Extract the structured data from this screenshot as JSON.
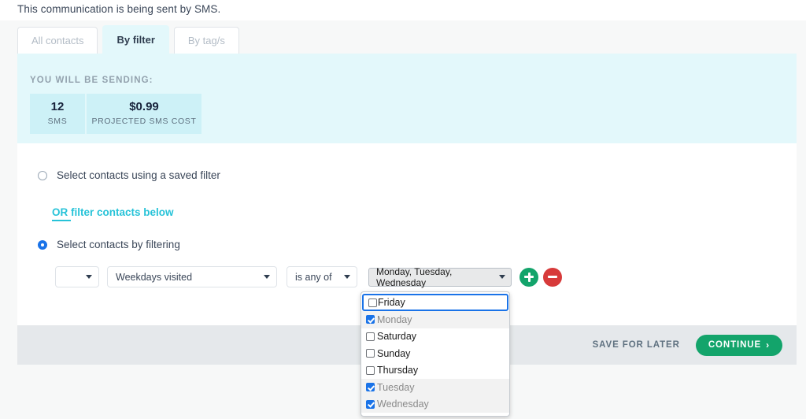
{
  "notice": "This communication is being sent by SMS.",
  "tabs": [
    {
      "label": "All contacts",
      "active": false
    },
    {
      "label": "By filter",
      "active": true
    },
    {
      "label": "By tag/s",
      "active": false
    }
  ],
  "summary": {
    "title": "YOU WILL BE SENDING:",
    "stats": [
      {
        "value": "12",
        "label": "SMS"
      },
      {
        "value": "$0.99",
        "label": "PROJECTED SMS COST"
      }
    ]
  },
  "options_section": {
    "saved_filter_label": "Select contacts using a saved filter",
    "or_link_label": "OR filter contacts below",
    "filtering_label": "Select contacts by filtering"
  },
  "filter_row": {
    "connector_value": "",
    "field_value": "Weekdays visited",
    "operator_value": "is any of",
    "values_value": "Monday, Tuesday, Wednesday",
    "add_icon": "plus-icon",
    "remove_icon": "minus-icon"
  },
  "dropdown": {
    "options": [
      {
        "label": "Friday",
        "checked": false,
        "focused": true
      },
      {
        "label": "Monday",
        "checked": true,
        "focused": false
      },
      {
        "label": "Saturday",
        "checked": false,
        "focused": false
      },
      {
        "label": "Sunday",
        "checked": false,
        "focused": false
      },
      {
        "label": "Thursday",
        "checked": false,
        "focused": false
      },
      {
        "label": "Tuesday",
        "checked": true,
        "focused": false
      },
      {
        "label": "Wednesday",
        "checked": true,
        "focused": false
      }
    ]
  },
  "footer": {
    "save_label": "SAVE FOR LATER",
    "continue_label": "CONTINUE",
    "continue_chevron": "›"
  },
  "colors": {
    "accent_cyan": "#27c3d8",
    "panel_cyan": "#e3f8fb",
    "stat_cyan": "#cdf1f7",
    "green": "#13a46b",
    "red": "#d73a3a",
    "blue": "#1a73e8",
    "footer_gray": "#e5e8eb",
    "page_bg": "#f7f8f8"
  }
}
